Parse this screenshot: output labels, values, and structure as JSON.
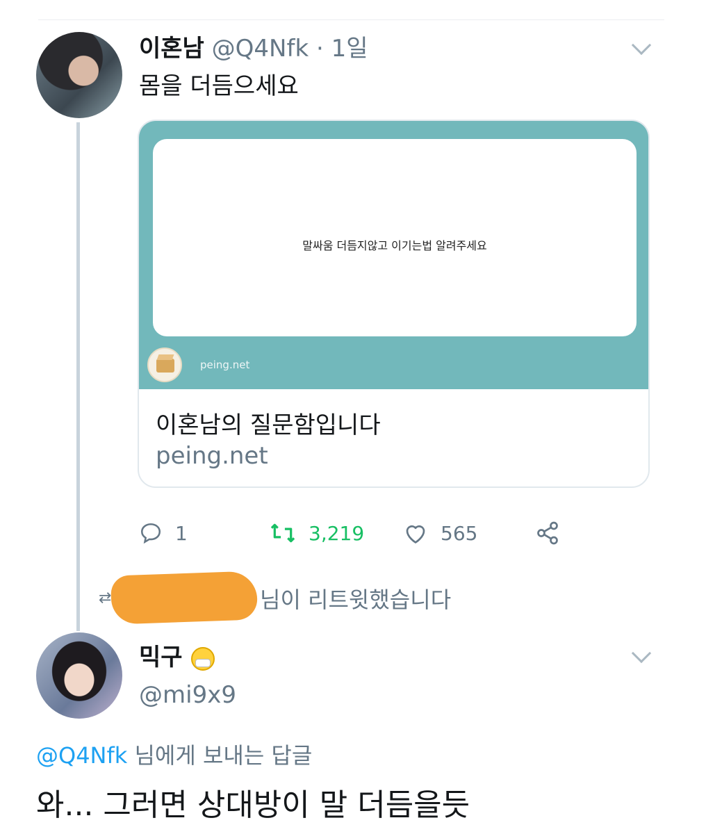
{
  "tweet1": {
    "name": "이혼남",
    "handle": "@Q4Nfk",
    "dot": "·",
    "time": "1일",
    "text": "몸을 더듬으세요",
    "card": {
      "question": "말싸움 더듬지않고 이기는법 알려주세요",
      "logo_label": "peing.net",
      "title": "이혼남의 질문함입니다",
      "domain": "peing.net",
      "accent_color": "#72b8bb"
    },
    "actions": {
      "reply_count": "1",
      "retweet_count": "3,219",
      "like_count": "565"
    }
  },
  "retweet_notice": {
    "text": "님이 리트윗했습니다"
  },
  "tweet2": {
    "name": "믹구",
    "handle": "@mi9x9",
    "reply_to_handle": "@Q4Nfk",
    "reply_to_suffix": " 님에게 보내는 답글",
    "text": "와... 그러면 상대방이 말 더듬을듯"
  },
  "icons": [
    "chevron-down-icon",
    "reply-icon",
    "retweet-icon",
    "heart-icon",
    "share-icon",
    "mask-emoji-icon",
    "box-logo-icon"
  ]
}
